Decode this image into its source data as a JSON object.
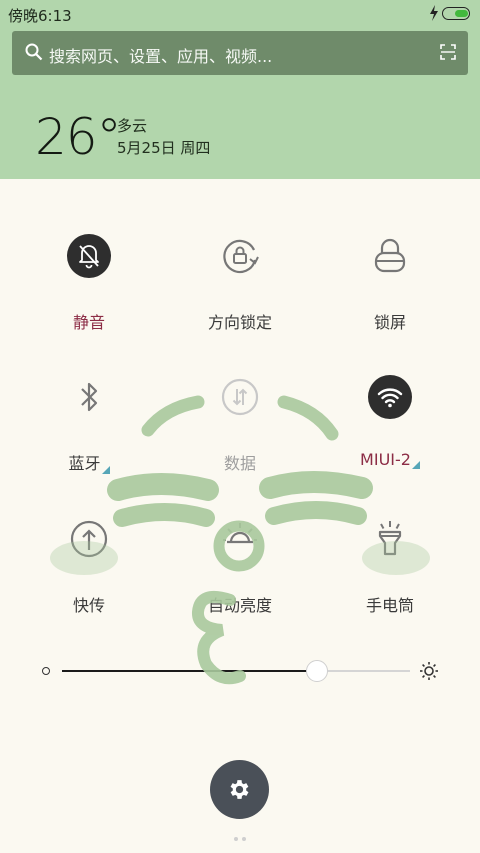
{
  "status": {
    "time": "傍晚6:13",
    "battery_level": 0.5,
    "charging": true
  },
  "search": {
    "placeholder": "搜索网页、设置、应用、视频..."
  },
  "weather": {
    "temperature": "26°",
    "condition": "多云",
    "date": "5月25日 周四"
  },
  "tiles": [
    {
      "label": "静音",
      "icon": "bell-off-icon",
      "active": true
    },
    {
      "label": "方向锁定",
      "icon": "rotation-lock-icon",
      "active": false
    },
    {
      "label": "锁屏",
      "icon": "lock-icon",
      "active": false
    },
    {
      "label": "蓝牙",
      "icon": "bluetooth-icon",
      "active": false
    },
    {
      "label": "数据",
      "icon": "data-arrows-icon",
      "active": false
    },
    {
      "label": "MIUI-2",
      "icon": "wifi-icon",
      "active": true
    },
    {
      "label": "快传",
      "icon": "upload-icon",
      "active": false
    },
    {
      "label": "自动亮度",
      "icon": "auto-brightness-icon",
      "active": false
    },
    {
      "label": "手电筒",
      "icon": "flashlight-icon",
      "active": false
    }
  ],
  "brightness": {
    "level": 0.74
  },
  "colors": {
    "accent": "#8c2d46",
    "header_bg": "#b2d6ac",
    "panel_bg": "#fbf9f1"
  }
}
